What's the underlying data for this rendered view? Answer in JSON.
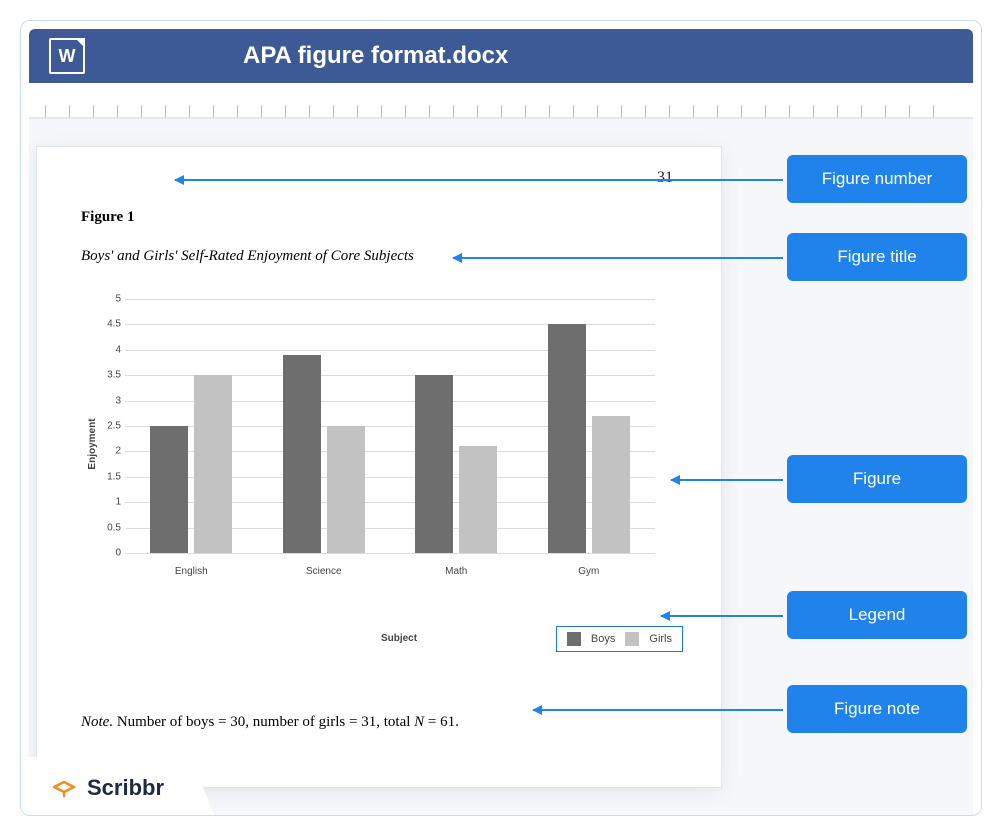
{
  "window": {
    "title": "APA figure format.docx",
    "app_icon_letter": "W"
  },
  "page": {
    "number": "31",
    "figure_number": "Figure 1",
    "figure_title": "Boys' and Girls' Self-Rated Enjoyment of Core Subjects",
    "note_label": "Note.",
    "note_text": " Number of boys = 30, number of girls = 31, total ",
    "note_n_italic": "N",
    "note_tail": " = 61."
  },
  "chart_data": {
    "type": "bar",
    "title": "Boys' and Girls' Self-Rated Enjoyment of Core Subjects",
    "xlabel": "Subject",
    "ylabel": "Enjoyment",
    "ylim": [
      0,
      5
    ],
    "y_ticks": [
      0,
      0.5,
      1,
      1.5,
      2,
      2.5,
      3,
      3.5,
      4,
      4.5,
      5
    ],
    "categories": [
      "English",
      "Science",
      "Math",
      "Gym"
    ],
    "series": [
      {
        "name": "Boys",
        "values": [
          2.5,
          3.9,
          3.5,
          4.5
        ],
        "color": "#6e6e6e"
      },
      {
        "name": "Girls",
        "values": [
          3.5,
          2.5,
          2.1,
          2.7
        ],
        "color": "#c2c2c2"
      }
    ]
  },
  "callouts": {
    "figure_number": "Figure number",
    "figure_title": "Figure title",
    "figure": "Figure",
    "legend": "Legend",
    "figure_note": "Figure note"
  },
  "brand": {
    "name": "Scribbr"
  }
}
